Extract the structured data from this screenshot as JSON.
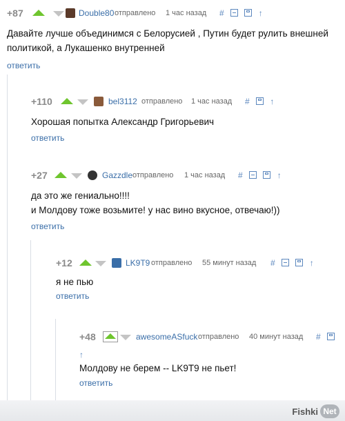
{
  "comments": [
    {
      "score": "+87",
      "user": "Double80",
      "sent": "отправлено",
      "time": "1 час назад",
      "tools": [
        "#",
        "⊟",
        "⊡",
        "↑"
      ],
      "text": [
        "Давайте лучше объединимся с Белорусией , Путин будет рулить внешней",
        "политикой, а Лукашенко внутренней"
      ],
      "reply": "ответить"
    },
    {
      "score": "+110",
      "user": "bel3112",
      "sent": "отправлено",
      "time": "1 час назад",
      "tools": [
        "#",
        "⊡",
        "↑"
      ],
      "text": [
        "Хорошая попытка Александр Григорьевич"
      ],
      "reply": "ответить"
    },
    {
      "score": "+27",
      "user": "Gazzdle",
      "sent": "отправлено",
      "time": "1 час назад",
      "tools": [
        "#",
        "⊟",
        "⊡",
        "↑"
      ],
      "text": [
        "да это же гениально!!!!",
        "и Молдову тоже возьмите! у нас вино вкусное, отвечаю!))"
      ],
      "reply": "ответить"
    },
    {
      "score": "+12",
      "user": "LK9T9",
      "sent": "отправлено",
      "time": "55 минут назад",
      "tools": [
        "#",
        "⊟",
        "⊡",
        "↑"
      ],
      "text": [
        "я не пью"
      ],
      "reply": "ответить"
    },
    {
      "score": "+48",
      "user": "awesomeASfuck",
      "sent": "отправлено",
      "time": "40 минут назад",
      "tools": [
        "#",
        "⊡",
        "↑"
      ],
      "text": [
        "Молдову не берем -- LK9T9 не пьет!"
      ],
      "reply": "ответить"
    }
  ],
  "footer": {
    "brand_left": "Fishki",
    "brand_right": "Net"
  },
  "colors": {
    "upvote": "#6fc52e",
    "downvote": "#c4c4c4",
    "link": "#3a6ea8",
    "score": "#8a8a8a"
  }
}
